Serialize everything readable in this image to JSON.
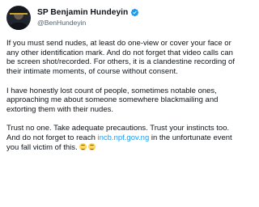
{
  "author": {
    "name": "SP Benjamin Hundeyin",
    "handle": "@BenHundeyin",
    "verified_color": "#1d9bf0"
  },
  "tweet": {
    "p1": "If you must send nudes, at least do one-view or cover your face or any other identification mark. And do not forget that video calls can be screen shot/recorded. For others, it is a clandestine recording of their intimate moments, of course without consent.",
    "p2": "I have honestly lost count of people, sometimes notable ones, approaching me about someone somewhere blackmailing and extorting them with their nudes.",
    "p3_before_link": "Trust no one. Take adequate precautions. Trust your instincts too. And do not forget to reach ",
    "p3_link": "incb.npf.gov.ng",
    "p3_after_link": " in the unfortunate event you fall victim of this.",
    "emojis": [
      "grimacing-smile-emoji",
      "grimacing-smile-emoji"
    ]
  },
  "colors": {
    "text": "#0f1419",
    "secondary": "#536471",
    "link": "#1d9bf0"
  }
}
